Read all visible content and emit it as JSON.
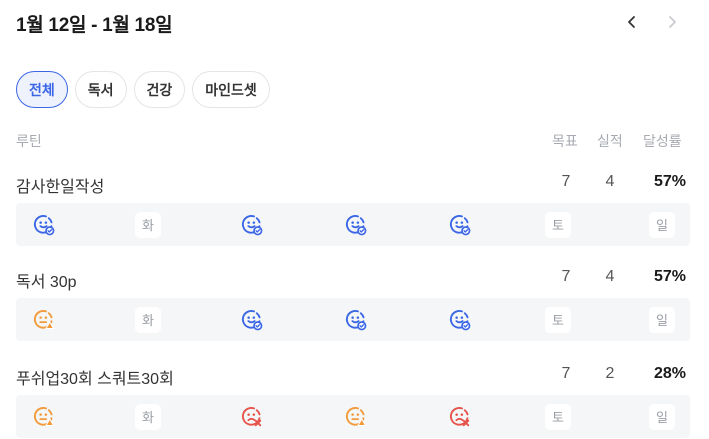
{
  "header": {
    "title": "1월 12일 - 1월 18일"
  },
  "tabs": [
    {
      "label": "전체",
      "active": true
    },
    {
      "label": "독서",
      "active": false
    },
    {
      "label": "건강",
      "active": false
    },
    {
      "label": "마인드셋",
      "active": false
    }
  ],
  "columns": {
    "routine": "루틴",
    "goal": "목표",
    "actual": "실적",
    "rate": "달성률"
  },
  "colors": {
    "good": "#3b67e6",
    "warn": "#f29a3a",
    "bad": "#e5534b",
    "accent": "#3b67e6"
  },
  "routines": [
    {
      "name": "감사한일작성",
      "goal": "7",
      "actual": "4",
      "rate": "57%",
      "days": [
        {
          "status": "good"
        },
        {
          "label": "화"
        },
        {
          "status": "good"
        },
        {
          "status": "good"
        },
        {
          "status": "good"
        },
        {
          "label": "토"
        },
        {
          "label": "일"
        }
      ]
    },
    {
      "name": "독서 30p",
      "goal": "7",
      "actual": "4",
      "rate": "57%",
      "days": [
        {
          "status": "warn"
        },
        {
          "label": "화"
        },
        {
          "status": "good"
        },
        {
          "status": "good"
        },
        {
          "status": "good"
        },
        {
          "label": "토"
        },
        {
          "label": "일"
        }
      ]
    },
    {
      "name": "푸쉬업30회 스쿼트30회",
      "goal": "7",
      "actual": "2",
      "rate": "28%",
      "days": [
        {
          "status": "warn"
        },
        {
          "label": "화"
        },
        {
          "status": "bad"
        },
        {
          "status": "warn"
        },
        {
          "status": "bad"
        },
        {
          "label": "토"
        },
        {
          "label": "일"
        }
      ]
    }
  ]
}
